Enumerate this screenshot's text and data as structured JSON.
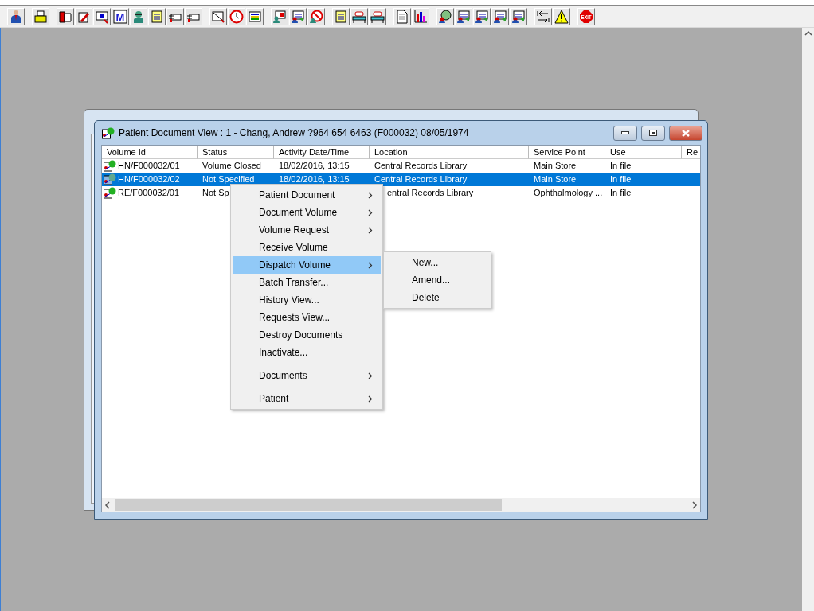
{
  "toolbar": {
    "groups": [
      [
        {
          "kind": "person"
        }
      ],
      [
        {
          "kind": "printer"
        }
      ],
      [
        {
          "kind": "book"
        },
        {
          "kind": "pencil"
        },
        {
          "kind": "screen"
        },
        {
          "kind": "letter",
          "label": "M"
        },
        {
          "kind": "doctor"
        },
        {
          "kind": "note"
        },
        {
          "kind": "hand"
        },
        {
          "kind": "hand"
        }
      ],
      [
        {
          "kind": "ruler"
        },
        {
          "kind": "clock"
        },
        {
          "kind": "list"
        }
      ],
      [
        {
          "kind": "monitor"
        },
        {
          "kind": "form"
        },
        {
          "kind": "no-entry"
        }
      ],
      [
        {
          "kind": "note"
        },
        {
          "kind": "bed"
        },
        {
          "kind": "bed"
        }
      ],
      [
        {
          "kind": "page"
        },
        {
          "kind": "bar-chart"
        }
      ],
      [
        {
          "kind": "globe"
        },
        {
          "kind": "form"
        },
        {
          "kind": "form"
        },
        {
          "kind": "form"
        },
        {
          "kind": "form"
        }
      ],
      [
        {
          "kind": "arrows"
        },
        {
          "kind": "warning"
        }
      ],
      [
        {
          "kind": "stop-sign",
          "label": "EXIT"
        }
      ]
    ]
  },
  "window": {
    "title": "Patient Document View : 1 - Chang, Andrew ?964 654 6463 (F000032) 08/05/1974",
    "table": {
      "columns": [
        "Volume Id",
        "Status",
        "Activity Date/Time",
        "Location",
        "Service Point",
        "Use",
        "Re"
      ],
      "rows": [
        {
          "selected": false,
          "cells": [
            "HN/F000032/01",
            "Volume Closed",
            "18/02/2016, 13:15",
            "Central Records Library",
            "Main Store",
            "In file"
          ]
        },
        {
          "selected": true,
          "cells": [
            "HN/F000032/02",
            "Not Specified",
            "18/02/2016, 13:15",
            "Central Records Library",
            "Main Store",
            "In file"
          ]
        },
        {
          "selected": false,
          "cells": [
            "RE/F000032/01",
            "Not Sp",
            null,
            "entral Records Library",
            "Ophthalmology ...",
            "In file"
          ]
        }
      ]
    }
  },
  "context_menu": {
    "items": [
      {
        "kind": "item",
        "label": "Patient Document",
        "submenu": true,
        "selected": false
      },
      {
        "kind": "item",
        "label": "Document Volume",
        "submenu": true,
        "selected": false
      },
      {
        "kind": "item",
        "label": "Volume Request",
        "submenu": true,
        "selected": false
      },
      {
        "kind": "item",
        "label": "Receive Volume",
        "submenu": false,
        "selected": false
      },
      {
        "kind": "item",
        "label": "Dispatch Volume",
        "submenu": true,
        "selected": true
      },
      {
        "kind": "item",
        "label": "Batch Transfer...",
        "submenu": false,
        "selected": false
      },
      {
        "kind": "item",
        "label": "History View...",
        "submenu": false,
        "selected": false
      },
      {
        "kind": "item",
        "label": "Requests View...",
        "submenu": false,
        "selected": false
      },
      {
        "kind": "item",
        "label": "Destroy Documents",
        "submenu": false,
        "selected": false
      },
      {
        "kind": "item",
        "label": "Inactivate...",
        "submenu": false,
        "selected": false
      },
      {
        "kind": "separator"
      },
      {
        "kind": "item",
        "label": "Documents",
        "submenu": true,
        "selected": false
      },
      {
        "kind": "separator"
      },
      {
        "kind": "item",
        "label": "Patient",
        "submenu": true,
        "selected": false
      }
    ],
    "submenu": {
      "items": [
        "New...",
        "Amend...",
        "Delete"
      ]
    }
  }
}
